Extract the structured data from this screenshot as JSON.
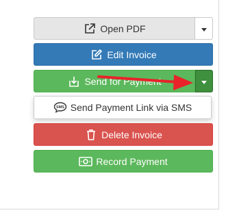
{
  "actions": {
    "open_pdf_label": "Open PDF",
    "edit_invoice_label": "Edit Invoice",
    "send_for_payment_label": "Send for Payment",
    "send_sms_label": "Send Payment Link via SMS",
    "delete_invoice_label": "Delete Invoice",
    "record_payment_label": "Record Payment"
  },
  "icons": {
    "open_pdf": "external-link-icon",
    "edit_invoice": "edit-icon",
    "send_for_payment": "download-icon",
    "send_sms": "sms-icon",
    "delete_invoice": "trash-icon",
    "record_payment": "money-icon"
  },
  "colors": {
    "primary": "#337ab7",
    "success": "#5cb85c",
    "success_dark": "#3e8f3e",
    "danger": "#d9534f",
    "default": "#e6e6e6",
    "annotation_arrow": "#e8232a"
  }
}
